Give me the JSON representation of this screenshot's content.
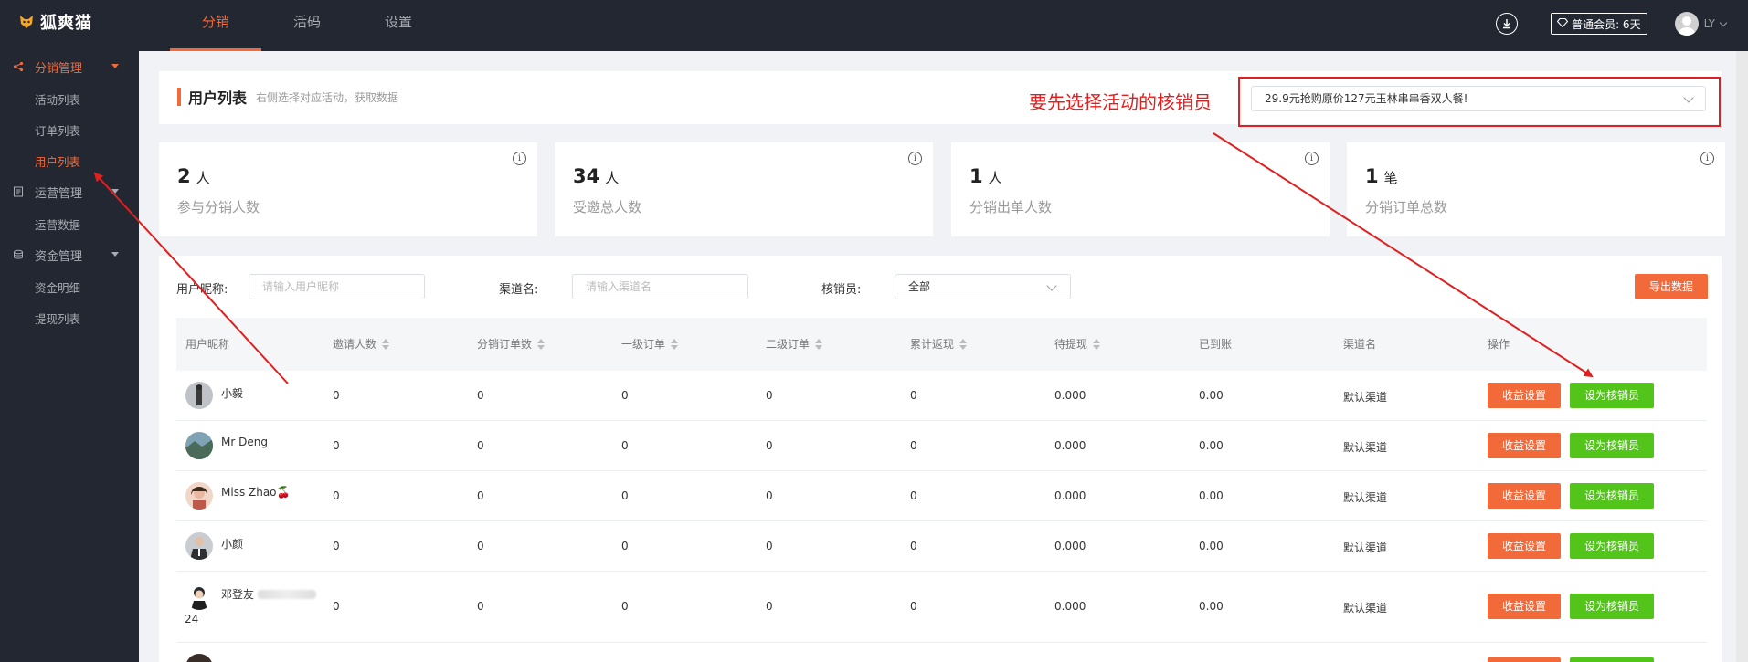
{
  "app": {
    "logo_text": "狐爽猫",
    "top_nav": [
      {
        "label": "分销",
        "active": true
      },
      {
        "label": "活码",
        "active": false
      },
      {
        "label": "设置",
        "active": false
      }
    ],
    "member_label": "普通会员: 6天",
    "user_name": "LY"
  },
  "sidebar": {
    "groups": [
      {
        "label": "分销管理",
        "active": true,
        "items": [
          {
            "label": "活动列表",
            "active": false
          },
          {
            "label": "订单列表",
            "active": false
          },
          {
            "label": "用户列表",
            "active": true
          }
        ]
      },
      {
        "label": "运营管理",
        "active": false,
        "items": [
          {
            "label": "运营数据",
            "active": false
          }
        ]
      },
      {
        "label": "资金管理",
        "active": false,
        "items": [
          {
            "label": "资金明细",
            "active": false
          },
          {
            "label": "提现列表",
            "active": false
          }
        ]
      }
    ]
  },
  "header": {
    "title": "用户列表",
    "subtitle": "右侧选择对应活动，获取数据",
    "annotation": "要先选择活动的核销员",
    "activity_select": "29.9元抢购原价127元玉林串串香双人餐!"
  },
  "stats": [
    {
      "value": "2",
      "unit": "人",
      "label": "参与分销人数"
    },
    {
      "value": "34",
      "unit": "人",
      "label": "受邀总人数"
    },
    {
      "value": "1",
      "unit": "人",
      "label": "分销出单人数"
    },
    {
      "value": "1",
      "unit": "笔",
      "label": "分销订单总数"
    }
  ],
  "filters": {
    "nickname_label": "用户昵称:",
    "nickname_placeholder": "请输入用户昵称",
    "channel_label": "渠道名:",
    "channel_placeholder": "请输入渠道名",
    "verifier_label": "核销员:",
    "verifier_value": "全部",
    "export_label": "导出数据"
  },
  "table": {
    "columns": [
      "用户昵称",
      "邀请人数",
      "分销订单数",
      "一级订单",
      "二级订单",
      "累计返现",
      "待提现",
      "已到账",
      "渠道名",
      "操作"
    ],
    "rows": [
      {
        "name": "小毅",
        "name2": "",
        "invites": "0",
        "orders": "0",
        "level1": "0",
        "level2": "0",
        "cashback": "0",
        "pending": "0.000",
        "received": "0.00",
        "channel": "默认渠道"
      },
      {
        "name": "Mr Deng",
        "name2": "",
        "invites": "0",
        "orders": "0",
        "level1": "0",
        "level2": "0",
        "cashback": "0",
        "pending": "0.000",
        "received": "0.00",
        "channel": "默认渠道"
      },
      {
        "name": "Miss Zhao🍒",
        "name2": "",
        "invites": "0",
        "orders": "0",
        "level1": "0",
        "level2": "0",
        "cashback": "0",
        "pending": "0.000",
        "received": "0.00",
        "channel": "默认渠道"
      },
      {
        "name": "小颜",
        "name2": "",
        "invites": "0",
        "orders": "0",
        "level1": "0",
        "level2": "0",
        "cashback": "0",
        "pending": "0.000",
        "received": "0.00",
        "channel": "默认渠道"
      },
      {
        "name": "邓登友",
        "name2": "24",
        "invites": "0",
        "orders": "0",
        "level1": "0",
        "level2": "0",
        "cashback": "0",
        "pending": "0.000",
        "received": "0.00",
        "channel": "默认渠道"
      }
    ],
    "btn_income": "收益设置",
    "btn_verifier": "设为核销员"
  },
  "colors": {
    "accent": "#f26a3a",
    "green": "#52c41a",
    "annotation": "#e02020",
    "dark_bg": "#232731"
  }
}
